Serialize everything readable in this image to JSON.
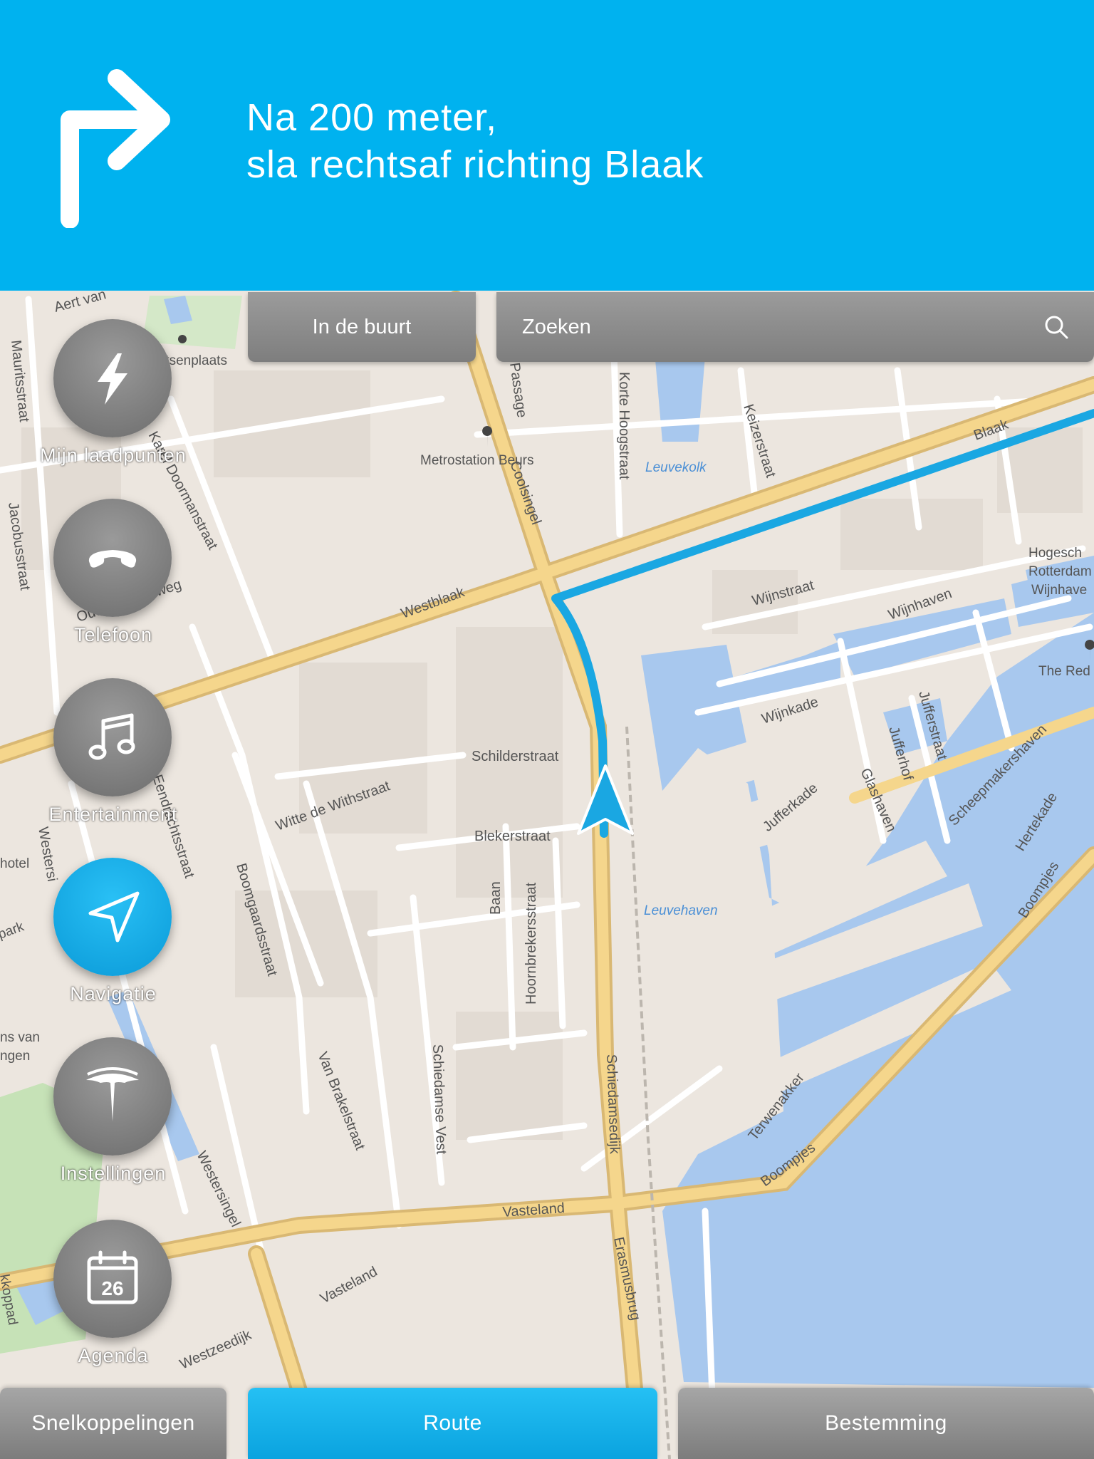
{
  "banner": {
    "line1": "Na 200 meter,",
    "line2": "sla rechtsaf richting Blaak",
    "icon": "turn-right-icon",
    "color": "#00b2ef"
  },
  "top_bar": {
    "nearby_label": "In de buurt",
    "search_label": "Zoeken"
  },
  "dock": [
    {
      "label": "Mijn laadpunten",
      "icon": "lightning-icon"
    },
    {
      "label": "Telefoon",
      "icon": "phone-icon"
    },
    {
      "label": "Entertainment",
      "icon": "music-note-icon"
    },
    {
      "label": "Navigatie",
      "icon": "navigation-arrow-icon",
      "active": true
    },
    {
      "label": "Instellingen",
      "icon": "tesla-logo-icon"
    },
    {
      "label": "Agenda",
      "icon": "calendar-icon",
      "day": "26"
    }
  ],
  "bottom_bar": {
    "shortcuts_label": "Snelkoppelingen",
    "route_label": "Route",
    "destination_label": "Bestemming"
  },
  "map": {
    "streets": [
      "Aert van",
      "Mauritsstraat",
      "Karel Doormanstraat",
      "Jacobusstraat",
      "Oude Binnenweg",
      "Westblaak",
      "Passage",
      "Korte Hoogstraat",
      "Keizerstraat",
      "Coolsingel",
      "Blaak",
      "Wijnstraat",
      "Wijnhaven",
      "Wijnkade",
      "Jufferstraat",
      "Jufferhof",
      "Jufferkade",
      "Glashaven",
      "Scheepmakershaven",
      "Hertekade",
      "Boompjes",
      "Schilderstraat",
      "Blekerstraat",
      "Witte de Withstraat",
      "Eendrachtsstraat",
      "Boomgaardsstraat",
      "Baan",
      "Hoornbrekersstraat",
      "Van Brakelstraat",
      "Schiedamse Vest",
      "Schiedamsedijk",
      "Westersingel",
      "Vasteland",
      "Erasmusbrug",
      "Westzeedijk",
      "Terwenakker",
      "Westersi"
    ],
    "pois": [
      "Metrostation Beurs",
      "Hogesch",
      "Rotterdam",
      "Wijnhave",
      "The Red",
      "rtsenplaats",
      "hotel",
      "park",
      "ns van",
      "ngen",
      "kkoppad"
    ],
    "water": [
      "Leuvekolk",
      "Leuvehaven"
    ],
    "route_color": "#1aa7e2"
  }
}
